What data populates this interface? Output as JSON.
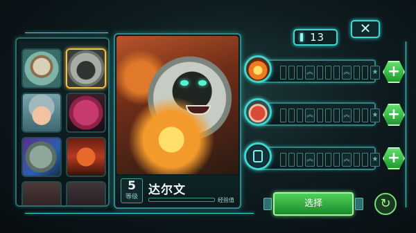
{
  "header": {
    "counter_value": "13",
    "close_label": "✕"
  },
  "roster": {
    "portraits": [
      {
        "icon": "astronaut-portrait",
        "selected": false
      },
      {
        "icon": "gorilla-portrait",
        "selected": true
      },
      {
        "icon": "girl-portrait",
        "selected": false
      },
      {
        "icon": "brain-monster-portrait",
        "selected": false
      },
      {
        "icon": "rock-golem-portrait",
        "selected": false
      },
      {
        "icon": "robot-portrait",
        "selected": false
      },
      {
        "icon": "partial-portrait",
        "selected": false
      },
      {
        "icon": "partial-portrait",
        "selected": false
      }
    ]
  },
  "hero": {
    "level": "5",
    "level_label": "等级",
    "name": "达尔文",
    "xp_label": "经验值",
    "xp_fraction": 0.0
  },
  "skills": [
    {
      "icon": "fire-fist-icon",
      "pips_filled": 0
    },
    {
      "icon": "punch-icon",
      "pips_filled": 0
    },
    {
      "icon": "robot-icon",
      "pips_filled": 0
    }
  ],
  "actions": {
    "select_label": "选择",
    "plus_label": "+",
    "refresh_label": "↻"
  },
  "colors": {
    "accent": "#3fd6d0",
    "select_green": "#4fd05a",
    "selected_border": "#f0c24a"
  }
}
